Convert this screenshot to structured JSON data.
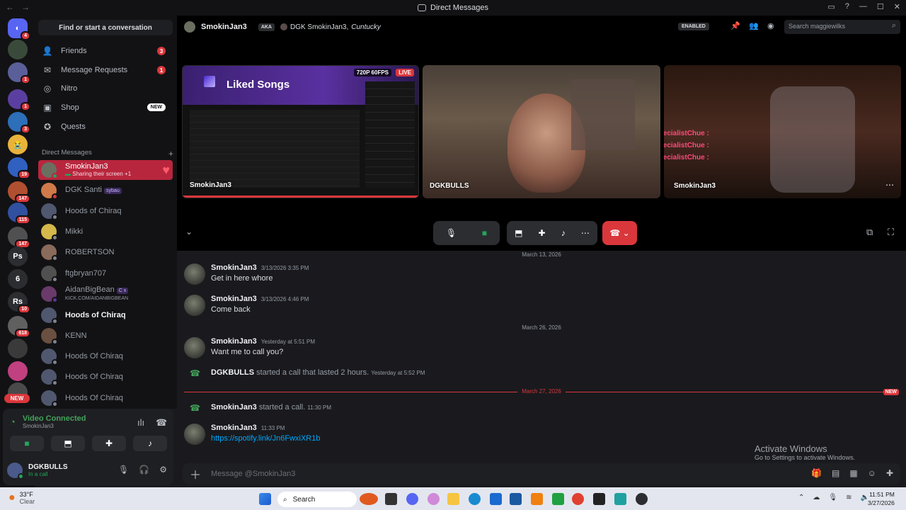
{
  "titlebar": {
    "title": "Direct Messages"
  },
  "servers": [
    {
      "badge": "4",
      "color": "#5865f2"
    },
    {
      "badge": "",
      "color": "#3a4a3a"
    },
    {
      "badge": "1",
      "color": "#5a5f9a"
    },
    {
      "badge": "1",
      "color": "#5b3fa0"
    },
    {
      "badge": "3",
      "color": "#2d6fb8"
    },
    {
      "badge": "",
      "color": "#e8b33a"
    },
    {
      "badge": "19",
      "color": "#3060c0"
    },
    {
      "badge": "147",
      "color": "#b05030"
    },
    {
      "badge": "115",
      "color": "#3050a0"
    },
    {
      "badge": "147",
      "color": "#505050"
    },
    {
      "badge": "",
      "color": "#2b2d31",
      "text": "Ps"
    },
    {
      "badge": "",
      "color": "#2b2d31",
      "text": "6"
    },
    {
      "badge": "10",
      "color": "#2b2d31",
      "text": "Rs"
    },
    {
      "badge": "618",
      "color": "#606060"
    },
    {
      "badge": "",
      "color": "#3a3a3a"
    },
    {
      "badge": "",
      "color": "#c04080"
    },
    {
      "badge": "",
      "color": "#4a4a4a"
    }
  ],
  "server_new": "NEW",
  "sidebar": {
    "find": "Find or start a conversation",
    "nav": [
      {
        "label": "Friends",
        "badge": "3",
        "icon": "friends-icon"
      },
      {
        "label": "Message Requests",
        "badge": "1",
        "icon": "mail-icon"
      },
      {
        "label": "Nitro",
        "badge": "",
        "icon": "nitro-icon"
      },
      {
        "label": "Shop",
        "badge": "NEW",
        "icon": "shop-icon"
      },
      {
        "label": "Quests",
        "badge": "",
        "icon": "quests-icon"
      }
    ],
    "dm_header": "Direct Messages",
    "dm_add": "+",
    "dms": [
      {
        "name": "SmokinJan3",
        "sub": "Sharing their screen +1",
        "active": true,
        "color": "#6a6f60"
      },
      {
        "name": "DGK Santi",
        "tag": "sybau",
        "sub": "",
        "color": "#d07a4a"
      },
      {
        "name": "Hoods of Chiraq",
        "sub": "",
        "color": "#505870"
      },
      {
        "name": "Mikki",
        "sub": "",
        "color": "#d4b84a"
      },
      {
        "name": "ROBERTSON",
        "sub": "",
        "color": "#8a6a5a"
      },
      {
        "name": "ftgbryan707",
        "sub": "",
        "color": "#505050"
      },
      {
        "name": "AidanBigBean",
        "tag": "C x",
        "sub": "KICK.COM/AIDANBIGBEAN",
        "color": "#6a3a6a"
      },
      {
        "name": "Hoods of Chiraq",
        "sub": "",
        "color": "#505870",
        "bold": true
      },
      {
        "name": "KENN",
        "sub": "",
        "color": "#6a5040"
      },
      {
        "name": "Hoods Of Chiraq",
        "sub": "",
        "color": "#505870"
      },
      {
        "name": "Hoods Of Chiraq",
        "sub": "",
        "color": "#505870"
      },
      {
        "name": "Hoods Of Chiraq",
        "sub": "",
        "color": "#505870"
      }
    ]
  },
  "voice": {
    "status": "Video Connected",
    "channel": "SmokinJan3",
    "user": "DGKBULLS",
    "user_status": "In a call"
  },
  "header": {
    "name": "SmokinJan3",
    "aka": "AKA",
    "aka_names": "DGK SmokinJan3,",
    "aka_fancy": "Cuntucky",
    "enabled": "ENABLED",
    "search_placeholder": "Search maggiewilks"
  },
  "call": {
    "stream_quality": "720P 60FPS",
    "live": "LIVE",
    "stream_title": "Liked Songs",
    "tiles": [
      "SmokinJan3",
      "DGKBULLS",
      "SmokinJan3"
    ],
    "overlay_name": "SpecialistChue :",
    "overlay_names": [
      "SpecialistChue :",
      "SpecialistChue :",
      "SpecialistChue :"
    ]
  },
  "messages": [
    {
      "type": "date",
      "text": "March 13, 2026"
    },
    {
      "type": "msg",
      "name": "SmokinJan3",
      "time": "3/13/2026 3:35 PM",
      "text": "Get in here whore"
    },
    {
      "type": "msg",
      "name": "SmokinJan3",
      "time": "3/13/2026 4:46 PM",
      "text": "Come back"
    },
    {
      "type": "date",
      "text": "March 26, 2026"
    },
    {
      "type": "msg",
      "name": "SmokinJan3",
      "time": "Yesterday at 5:51 PM",
      "text": "Want me to call you?"
    },
    {
      "type": "sys",
      "name": "DGKBULLS",
      "text": "started a call that lasted 2 hours.",
      "time": "Yesterday at 5:52 PM"
    },
    {
      "type": "date",
      "text": "March 27, 2026",
      "new": "NEW"
    },
    {
      "type": "sys",
      "name": "SmokinJan3",
      "text": "started a call.",
      "time": "11:30 PM"
    },
    {
      "type": "msg",
      "name": "SmokinJan3",
      "time": "11:33 PM",
      "text": "https://spotify.link/Jn6FwxiXR1b",
      "link": true
    }
  ],
  "input": {
    "placeholder": "Message @SmokinJan3"
  },
  "activate": {
    "title": "Activate Windows",
    "sub": "Go to Settings to activate Windows."
  },
  "taskbar": {
    "temp": "33°F",
    "weather": "Clear",
    "search": "Search",
    "time": "11:51 PM",
    "date": "3/27/2026"
  }
}
